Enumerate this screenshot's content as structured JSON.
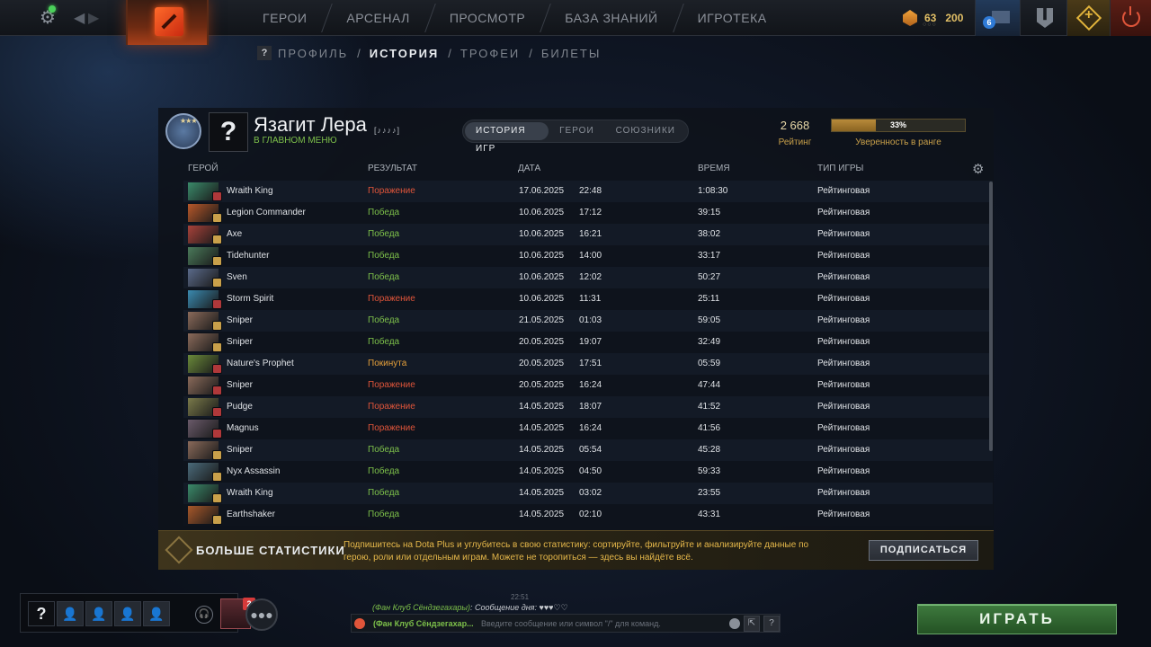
{
  "topbar": {
    "nav": [
      "Герои",
      "Арсенал",
      "Просмотр",
      "База знаний",
      "Игротека"
    ],
    "shards": "63",
    "currency2": "200",
    "mail_count": "6"
  },
  "subnav": {
    "help": "?",
    "items": [
      "Профиль",
      "История",
      "Трофеи",
      "Билеты"
    ],
    "active": "История",
    "separator": "/"
  },
  "profile": {
    "avatar": "?",
    "name": "Язагит Лера",
    "tag": "[♪♪♪♪]",
    "status": "В главном меню",
    "tabs": [
      "История игр",
      "Герои",
      "Союзники"
    ],
    "active_tab": "История игр",
    "rating_value": "2 668",
    "rating_label": "Рейтинг",
    "confidence_percent": 33,
    "confidence_text": "33%",
    "confidence_label": "Уверенность в ранге"
  },
  "table": {
    "headers": {
      "hero": "Герой",
      "result": "Результат",
      "date": "Дата",
      "duration": "Время",
      "type": "Тип игры"
    },
    "rows": [
      {
        "hero": "Wraith King",
        "result": "Поражение",
        "outcome": "loss",
        "date": "17.06.2025",
        "time": "22:48",
        "duration": "1:08:30",
        "type": "Рейтинговая",
        "color": "#3a8a6a"
      },
      {
        "hero": "Legion Commander",
        "result": "Победа",
        "outcome": "win",
        "date": "10.06.2025",
        "time": "17:12",
        "duration": "39:15",
        "type": "Рейтинговая",
        "color": "#b8582a"
      },
      {
        "hero": "Axe",
        "result": "Победа",
        "outcome": "win",
        "date": "10.06.2025",
        "time": "16:21",
        "duration": "38:02",
        "type": "Рейтинговая",
        "color": "#a8423a"
      },
      {
        "hero": "Tidehunter",
        "result": "Победа",
        "outcome": "win",
        "date": "10.06.2025",
        "time": "14:00",
        "duration": "33:17",
        "type": "Рейтинговая",
        "color": "#4a7a5a"
      },
      {
        "hero": "Sven",
        "result": "Победа",
        "outcome": "win",
        "date": "10.06.2025",
        "time": "12:02",
        "duration": "50:27",
        "type": "Рейтинговая",
        "color": "#5a6a8a"
      },
      {
        "hero": "Storm Spirit",
        "result": "Поражение",
        "outcome": "loss",
        "date": "10.06.2025",
        "time": "11:31",
        "duration": "25:11",
        "type": "Рейтинговая",
        "color": "#3a8ab0"
      },
      {
        "hero": "Sniper",
        "result": "Победа",
        "outcome": "win",
        "date": "21.05.2025",
        "time": "01:03",
        "duration": "59:05",
        "type": "Рейтинговая",
        "color": "#8a6a5a"
      },
      {
        "hero": "Sniper",
        "result": "Победа",
        "outcome": "win",
        "date": "20.05.2025",
        "time": "19:07",
        "duration": "32:49",
        "type": "Рейтинговая",
        "color": "#8a6a5a"
      },
      {
        "hero": "Nature's Prophet",
        "result": "Покинута",
        "outcome": "abandon",
        "date": "20.05.2025",
        "time": "17:51",
        "duration": "05:59",
        "type": "Рейтинговая",
        "color": "#6a8a3a"
      },
      {
        "hero": "Sniper",
        "result": "Поражение",
        "outcome": "loss",
        "date": "20.05.2025",
        "time": "16:24",
        "duration": "47:44",
        "type": "Рейтинговая",
        "color": "#8a6a5a"
      },
      {
        "hero": "Pudge",
        "result": "Поражение",
        "outcome": "loss",
        "date": "14.05.2025",
        "time": "18:07",
        "duration": "41:52",
        "type": "Рейтинговая",
        "color": "#7a7a4a"
      },
      {
        "hero": "Magnus",
        "result": "Поражение",
        "outcome": "loss",
        "date": "14.05.2025",
        "time": "16:24",
        "duration": "41:56",
        "type": "Рейтинговая",
        "color": "#6a5a6a"
      },
      {
        "hero": "Sniper",
        "result": "Победа",
        "outcome": "win",
        "date": "14.05.2025",
        "time": "05:54",
        "duration": "45:28",
        "type": "Рейтинговая",
        "color": "#8a6a5a"
      },
      {
        "hero": "Nyx Assassin",
        "result": "Победа",
        "outcome": "win",
        "date": "14.05.2025",
        "time": "04:50",
        "duration": "59:33",
        "type": "Рейтинговая",
        "color": "#4a6a7a"
      },
      {
        "hero": "Wraith King",
        "result": "Победа",
        "outcome": "win",
        "date": "14.05.2025",
        "time": "03:02",
        "duration": "23:55",
        "type": "Рейтинговая",
        "color": "#3a8a6a"
      },
      {
        "hero": "Earthshaker",
        "result": "Победа",
        "outcome": "win",
        "date": "14.05.2025",
        "time": "02:10",
        "duration": "43:31",
        "type": "Рейтинговая",
        "color": "#a8582a"
      }
    ]
  },
  "promo": {
    "title": "Больше статистики",
    "text": "Подпишитесь на Dota Plus и углубитесь в свою статистику: сортируйте, фильтруйте и анализируйте данные по герою, роли или отдельным играм. Можете не торопиться — здесь вы найдёте всё.",
    "button": "Подписаться"
  },
  "party": {
    "self": "?",
    "invite_count": "2"
  },
  "chat": {
    "time": "22:51",
    "last_channel": "(Фан Клуб Сёндзегахары)",
    "last_message": ": Сообщение дня: ♥♥♥♡♡",
    "input_channel": "(Фан Клуб Сёндзегахар...",
    "placeholder": "Введите сообщение или символ \"/\" для команд.",
    "help": "?"
  },
  "play_button": "Играть",
  "colors": {
    "win": "#7dc04a",
    "loss": "#e0553a",
    "abandon": "#e6a03a",
    "accent_gold": "#e6b84a"
  }
}
